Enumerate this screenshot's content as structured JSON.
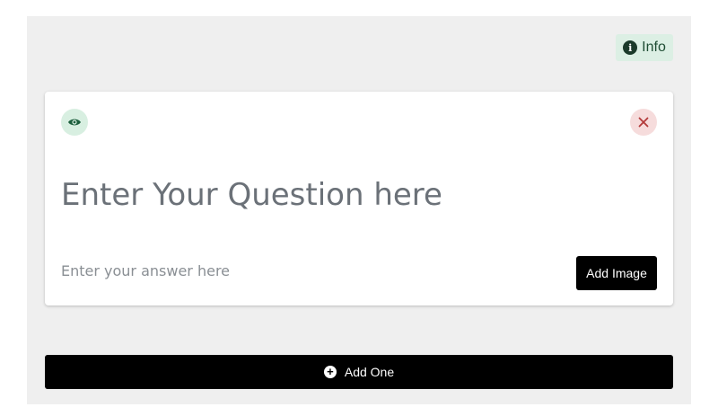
{
  "info_button": {
    "label": "Info",
    "glyph": "i",
    "icon": "info-circle-icon",
    "bg_color": "#dcefe4"
  },
  "question_card": {
    "visibility_icon": "eye-icon",
    "remove_icon": "close-icon",
    "question_placeholder": "Enter Your Question here",
    "answer_placeholder": "Enter your answer here",
    "add_image_label": "Add Image"
  },
  "add_one_button": {
    "label": "Add One",
    "icon": "plus-circle-icon",
    "glyph": "+"
  },
  "colors": {
    "panel_bg": "#efefef",
    "eye_accent": "#1b5e3c",
    "close_accent": "#b33a3a",
    "primary_button": "#000000"
  }
}
